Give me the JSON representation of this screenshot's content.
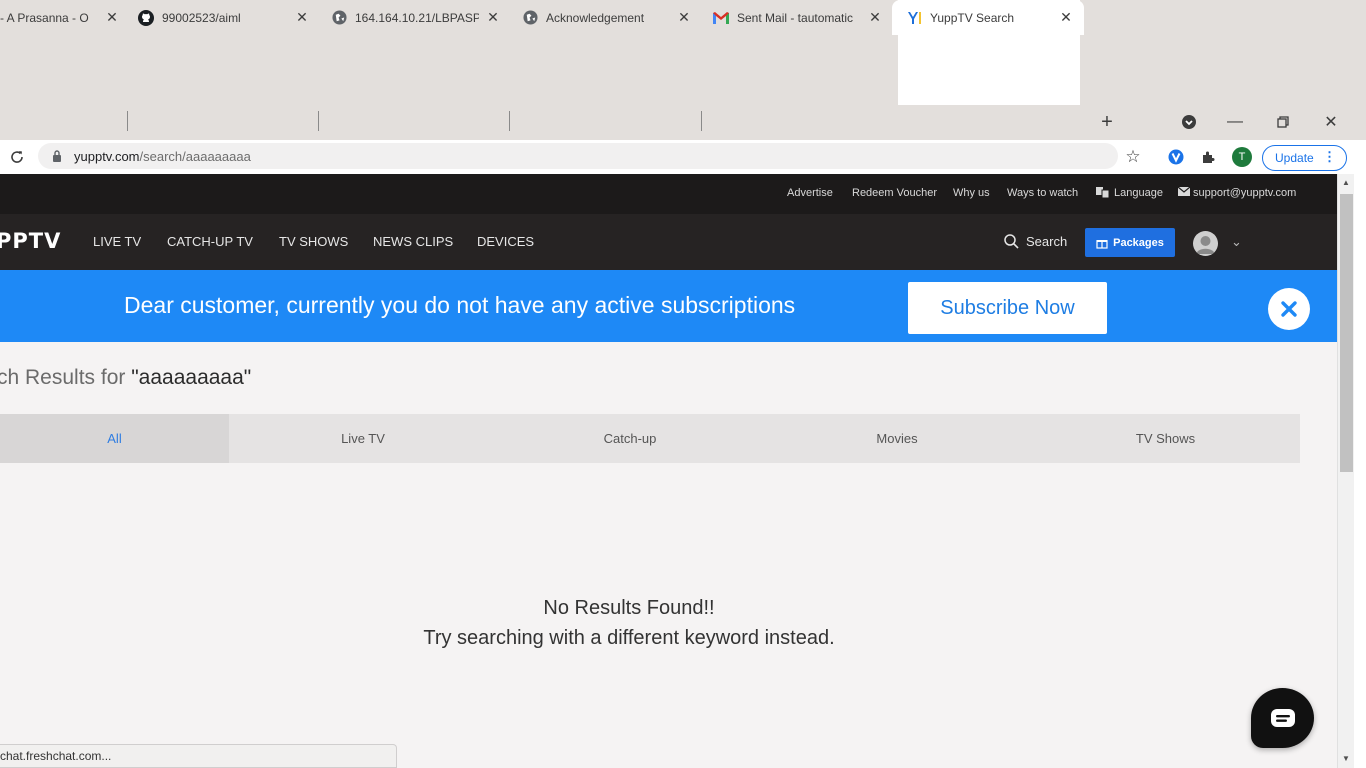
{
  "browser": {
    "tabs": [
      {
        "title": "- A Prasanna - O",
        "icon": "outlook-icon"
      },
      {
        "title": "99002523/aiml",
        "icon": "github-icon"
      },
      {
        "title": "164.164.10.21/LBPASP",
        "icon": "globe-icon"
      },
      {
        "title": "Acknowledgement",
        "icon": "globe-icon"
      },
      {
        "title": "Sent Mail - tautomatic",
        "icon": "gmail-icon"
      },
      {
        "title": "YuppTV Search",
        "icon": "yupptv-icon",
        "active": true
      }
    ],
    "url_domain": "yupptv.com",
    "url_path": "/search/aaaaaaaaa",
    "update_label": "Update",
    "profile_initial": "T",
    "status_text": "chat.freshchat.com..."
  },
  "utility_links": [
    "Advertise",
    "Redeem Voucher",
    "Why us",
    "Ways to watch",
    "Language",
    "support@yupptv.com"
  ],
  "nav": {
    "logo_text": "PPTV",
    "items": [
      "LIVE TV",
      "CATCH-UP TV",
      "TV SHOWS",
      "NEWS CLIPS",
      "DEVICES"
    ],
    "search_label": "Search",
    "packages_label": "Packages"
  },
  "banner": {
    "message": "Dear customer, currently you do not have any active subscriptions",
    "subscribe_label": "Subscribe Now"
  },
  "results": {
    "heading_prefix": "rch Results for ",
    "query": "\"aaaaaaaaa\"",
    "filters": [
      "All",
      "Live TV",
      "Catch-up",
      "Movies",
      "TV Shows"
    ],
    "active_filter": "All",
    "empty_title": "No Results Found!!",
    "empty_hint": "Try searching with a different keyword instead."
  },
  "colors": {
    "banner": "#1e89f6",
    "packages": "#1f6fe0",
    "active_filter_text": "#2f7de1",
    "nav_bg": "#262323"
  }
}
